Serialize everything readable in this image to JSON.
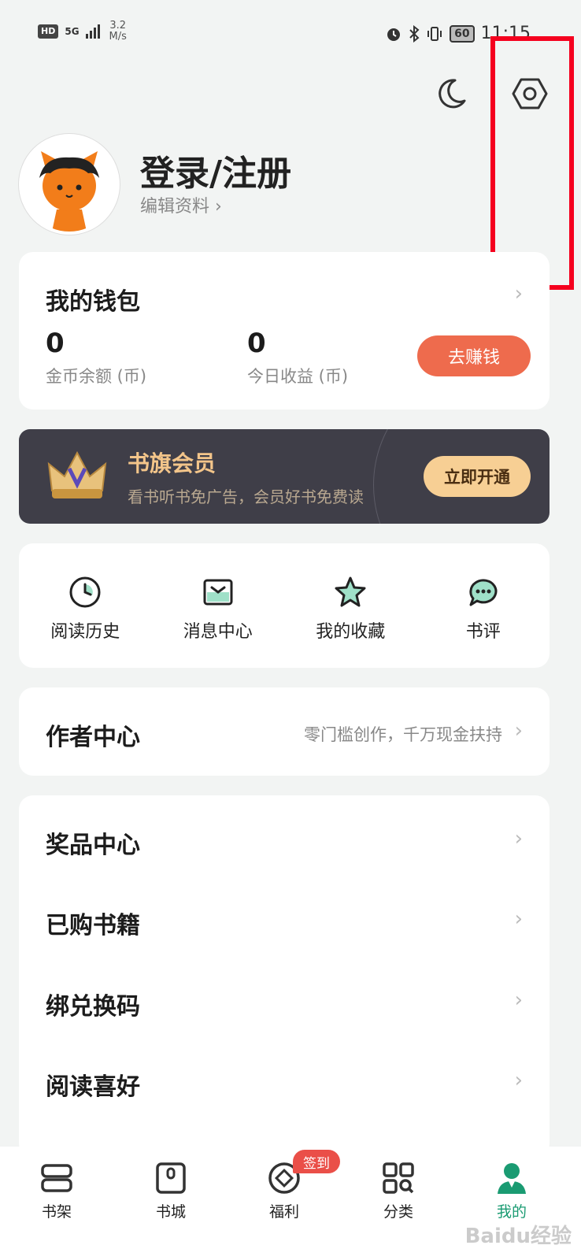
{
  "status_bar": {
    "hd": "HD",
    "network": "5G",
    "speed_value": "3.2",
    "speed_unit": "M/s",
    "battery": "60",
    "time": "11:15"
  },
  "profile": {
    "login_label": "登录/注册",
    "edit_label": "编辑资料 ›"
  },
  "wallet": {
    "title": "我的钱包",
    "coins_value": "0",
    "coins_label": "金币余额 (币)",
    "today_value": "0",
    "today_label": "今日收益 (币)",
    "earn_button": "去赚钱"
  },
  "vip": {
    "title": "书旗会员",
    "subtitle": "看书听书免广告，会员好书免费读",
    "button": "立即开通"
  },
  "shortcuts": [
    {
      "label": "阅读历史",
      "icon": "clock-icon"
    },
    {
      "label": "消息中心",
      "icon": "message-box-icon"
    },
    {
      "label": "我的收藏",
      "icon": "star-icon"
    },
    {
      "label": "书评",
      "icon": "comment-icon"
    }
  ],
  "author": {
    "title": "作者中心",
    "subtitle": "零门槛创作，千万现金扶持"
  },
  "menu": [
    {
      "label": "奖品中心"
    },
    {
      "label": "已购书籍"
    },
    {
      "label": "绑兑换码"
    },
    {
      "label": "阅读喜好"
    }
  ],
  "tabs": [
    {
      "label": "书架",
      "icon": "bookshelf-icon"
    },
    {
      "label": "书城",
      "icon": "bookstore-icon"
    },
    {
      "label": "福利",
      "icon": "coin-icon"
    },
    {
      "label": "分类",
      "icon": "category-icon"
    },
    {
      "label": "我的",
      "icon": "user-icon"
    }
  ],
  "checkin_badge": "签到",
  "watermark": "Baidu经验",
  "colors": {
    "accent": "#1a9b72",
    "earn_button": "#ee6b4d",
    "vip_background": "#3f3e48",
    "vip_gold": "#f3c58a",
    "highlight_box": "#f5001e"
  }
}
